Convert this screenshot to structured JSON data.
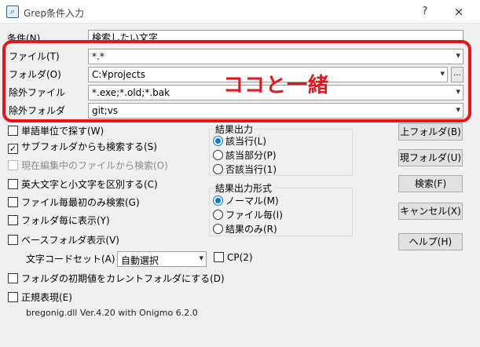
{
  "window": {
    "title": "Grep条件入力",
    "help": "?",
    "close": "×"
  },
  "fields": {
    "condition": {
      "label": "条件(N)",
      "value": "検索したい文字"
    },
    "file": {
      "label": "ファイル(T)",
      "value": "*.*"
    },
    "folder": {
      "label": "フォルダ(O)",
      "value": "C:¥projects",
      "browse": "..."
    },
    "exclude_file": {
      "label": "除外ファイル",
      "value": "*.exe;*.old;*.bak"
    },
    "exclude_folder": {
      "label": "除外フォルダ",
      "value": "git;vs"
    }
  },
  "annotation": "ココと一緒",
  "options": {
    "word": "単語単位で探す(W)",
    "subfolder": "サブフォルダからも検索する(S)",
    "current_file": "現在編集中のファイルから検索(O)",
    "case": "英大文字と小文字を区別する(C)",
    "first_match": "ファイル毎最初のみ検索(G)",
    "per_folder": "フォルダ毎に表示(Y)",
    "base_folder": "ベースフォルダ表示(V)",
    "charset_label": "文字コードセット(A)",
    "charset_value": "自動選択",
    "cp": "CP(2)",
    "init_folder": "フォルダの初期値をカレントフォルダにする(D)",
    "regex": "正規表現(E)"
  },
  "result_output": {
    "title": "結果出力",
    "items": [
      "該当行(L)",
      "該当部分(P)",
      "否該当行(1)"
    ]
  },
  "result_format": {
    "title": "結果出力形式",
    "items": [
      "ノーマル(M)",
      "ファイル毎(I)",
      "結果のみ(R)"
    ]
  },
  "buttons": {
    "up_folder": "上フォルダ(B)",
    "current_folder": "現フォルダ(U)",
    "search": "検索(F)",
    "cancel": "キャンセル(X)",
    "help": "ヘルプ(H)"
  },
  "status": "bregonig.dll Ver.4.20 with Onigmo 6.2.0",
  "icons": {
    "dropdown": "▾",
    "check": "✓",
    "app": "🔍"
  }
}
